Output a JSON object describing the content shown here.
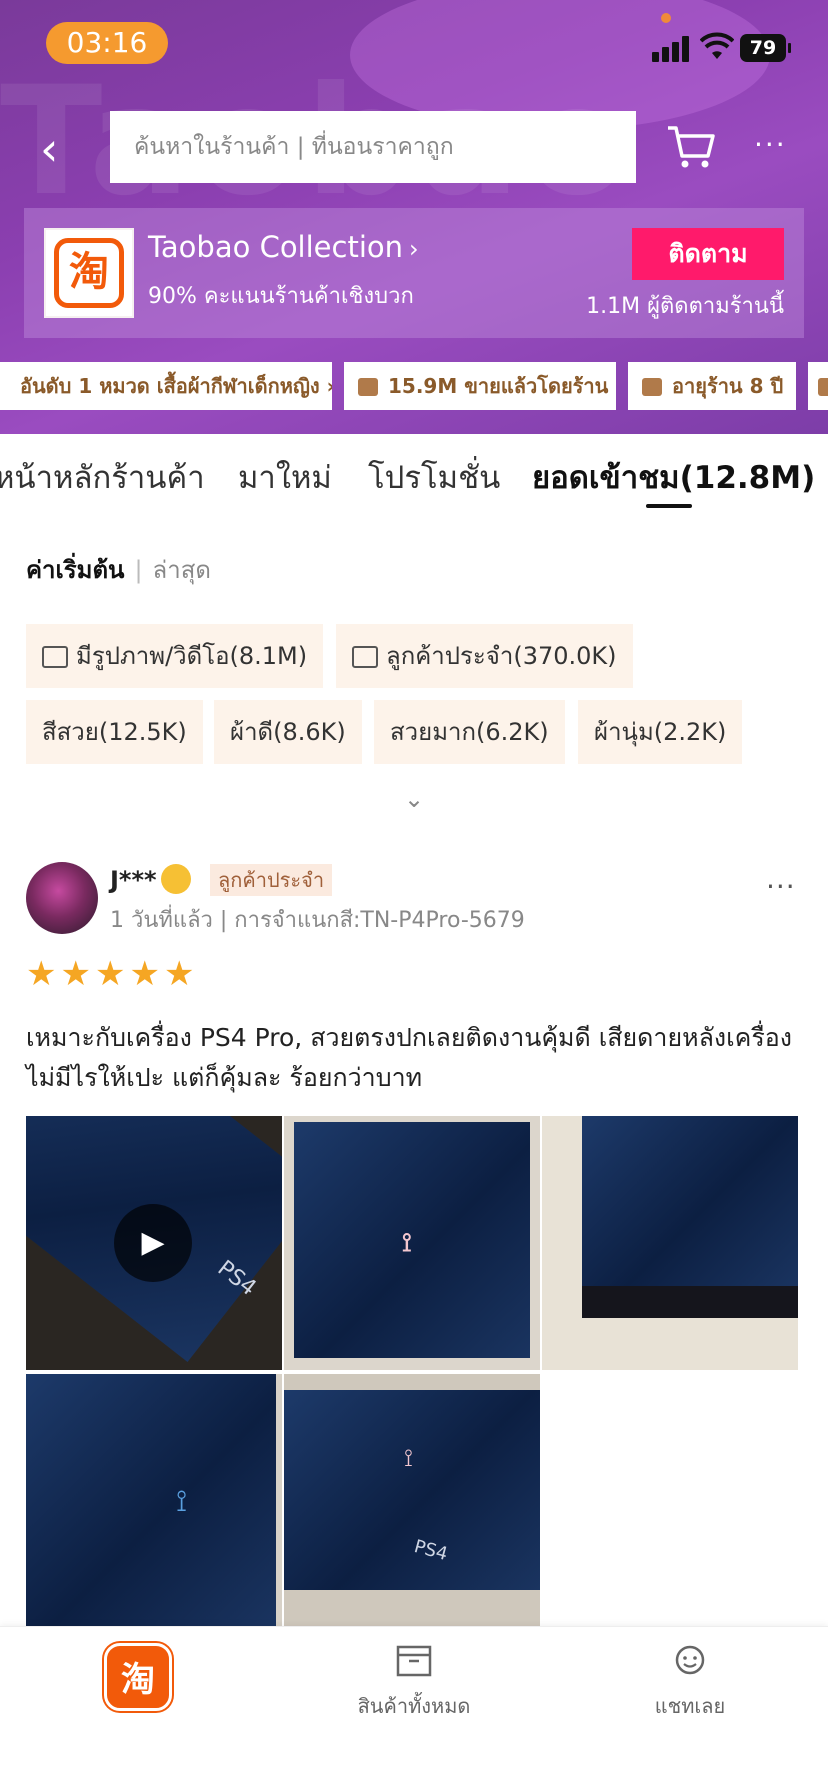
{
  "status_bar": {
    "time": "03:16",
    "battery": "79"
  },
  "search": {
    "placeholder": "ค้นหาในร้านค้า | ที่นอนราคาถูก"
  },
  "shop": {
    "name": "Taobao Collection",
    "logo_char": "淘",
    "rating": "90% คะแนนร้านค้าเชิงบวก",
    "follow_label": "ติดตาม",
    "followers": "1.1M ผู้ติดตามร้านนี้",
    "watermark": "Taobao"
  },
  "badges": [
    {
      "label": "อันดับ 1 หมวด เสื้อผ้ากีฬาเด็กหญิง"
    },
    {
      "label": "15.9M ขายแล้วโดยร้าน"
    },
    {
      "label": "อายุร้าน 8 ปี"
    }
  ],
  "tabs": [
    {
      "label": "หน้าหลักร้านค้า"
    },
    {
      "label": "มาใหม่"
    },
    {
      "label": "โปรโมชั่น"
    },
    {
      "label": "ยอดเข้าชม(12.8M)"
    }
  ],
  "sort": {
    "default": "ค่าเริ่มต้น",
    "separator": "|",
    "latest": "ล่าสุด"
  },
  "filters": [
    {
      "label": "มีรูปภาพ/วิดีโอ(8.1M)",
      "icon": "image-icon"
    },
    {
      "label": "ลูกค้าประจำ(370.0K)",
      "icon": "repeat-customer-icon"
    },
    {
      "label": "สีสวย(12.5K)"
    },
    {
      "label": "ผ้าดี(8.6K)"
    },
    {
      "label": "สวยมาก(6.2K)"
    },
    {
      "label": "ผ้านุ่ม(2.2K)"
    }
  ],
  "review": {
    "username": "J***",
    "member_tag": "ลูกค้าประจำ",
    "meta": "1 วันที่แล้ว | การจำแนกสี:TN-P4Pro-5679",
    "rating": 5,
    "text": "เหมาะกับเครื่อง PS4 Pro, สวยตรงปกเลยติดงานคุ้มดี เสียดายหลังเครื่องไม่มีไรให้เปะ แต่ก็คุ้มละ ร้อยกว่าบาท",
    "photos": [
      {
        "kind": "video",
        "label": "PS4"
      },
      {
        "kind": "image"
      },
      {
        "kind": "image"
      },
      {
        "kind": "image"
      },
      {
        "kind": "image",
        "label": "PS4"
      }
    ]
  },
  "bottom_nav": {
    "home_char": "淘",
    "all_products": "สินค้าทั้งหมด",
    "chat": "แชทเลย"
  },
  "colors": {
    "header_purple": "#8b3fb0",
    "follow_pink": "#ff1a6b",
    "brand_orange": "#f25a0a",
    "time_pill": "#f59a2f",
    "star": "#f5a623",
    "chip_bg": "#fdf3ea"
  }
}
